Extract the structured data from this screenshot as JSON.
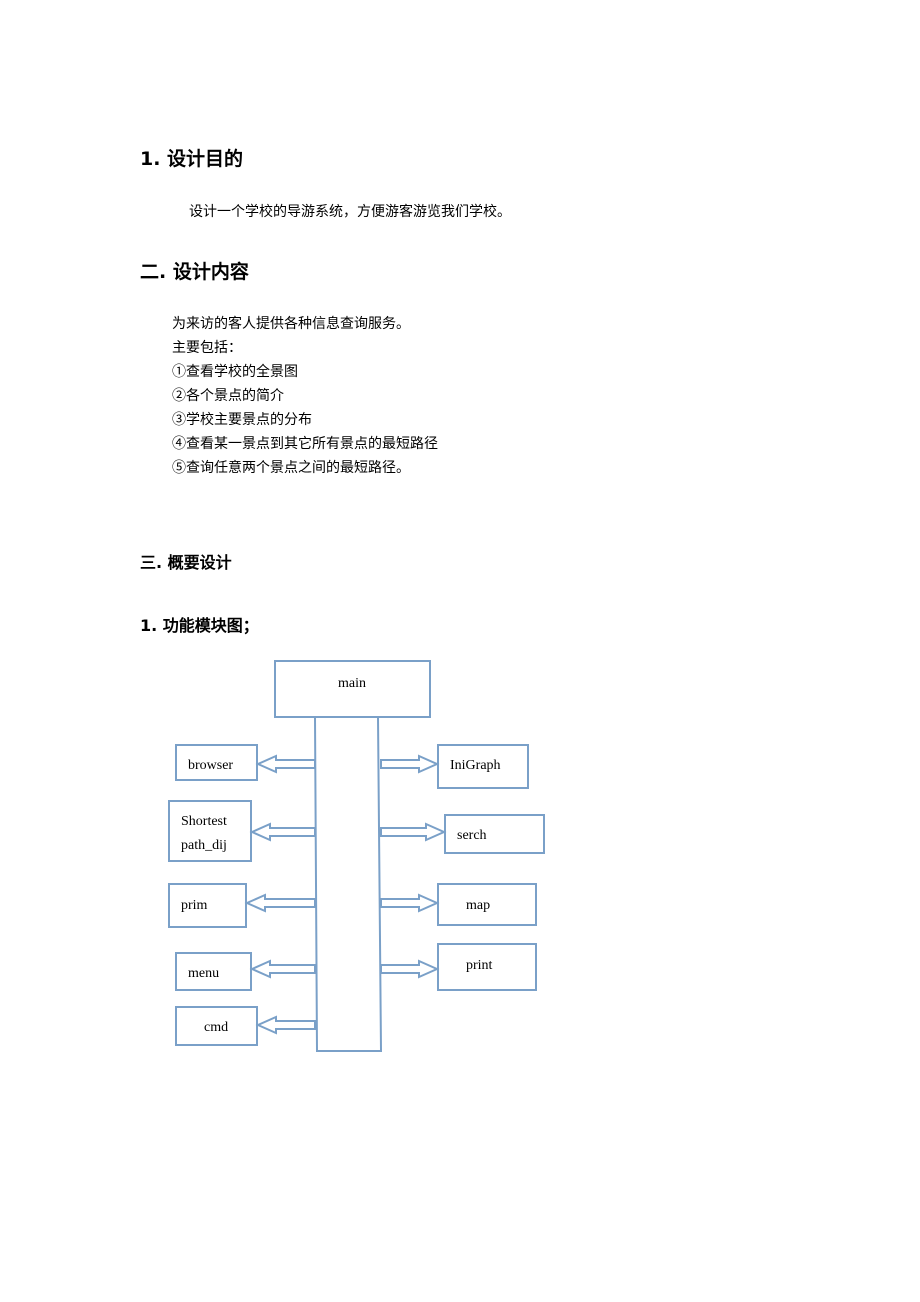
{
  "sections": {
    "s1": {
      "heading": "1.  设计目的",
      "text": "设计一个学校的导游系统，方便游客游览我们学校。"
    },
    "s2": {
      "heading": "二.  设计内容",
      "lines": [
        "为来访的客人提供各种信息查询服务。",
        "主要包括：",
        "①查看学校的全景图",
        "②各个景点的简介",
        "③学校主要景点的分布",
        "④查看某一景点到其它所有景点的最短路径",
        "⑤查询任意两个景点之间的最短路径。"
      ]
    },
    "s3": {
      "heading": "三.  概要设计",
      "subheading": "1.  功能模块图；"
    }
  },
  "diagram": {
    "stroke_color": "#7aa0c8",
    "root": "main",
    "left_modules": [
      "browser",
      "Shortest path_dij",
      "prim",
      "menu",
      "cmd"
    ],
    "left_module_lines": [
      [
        "browser"
      ],
      [
        "Shortest",
        "path_dij"
      ],
      [
        "prim"
      ],
      [
        "menu"
      ],
      [
        "cmd"
      ]
    ],
    "right_modules": [
      "IniGraph",
      "serch",
      "map",
      "print"
    ]
  }
}
